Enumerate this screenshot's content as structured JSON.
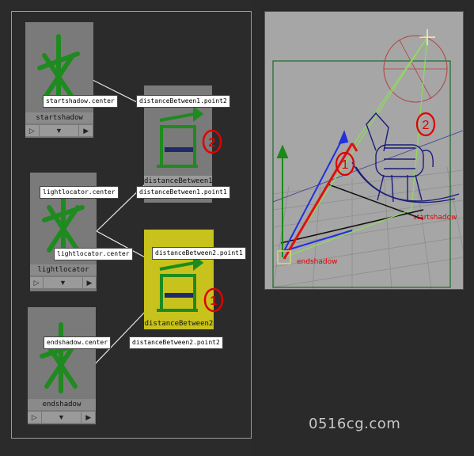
{
  "hypergraph": {
    "nodes": {
      "startshadow": {
        "label": "startshadow"
      },
      "dist1": {
        "label": "distanceBetween1"
      },
      "lightlocator": {
        "label": "lightlocator"
      },
      "dist2": {
        "label": "distanceBetween2"
      },
      "endshadow": {
        "label": "endshadow"
      }
    },
    "tags": {
      "t1": "startshadow.center",
      "t2": "distanceBetween1.point2",
      "t3": "lightlocator.center",
      "t4": "distanceBetween1.point1",
      "t5": "lightlocator.center",
      "t6": "distanceBetween2.point1",
      "t7": "endshadow.center",
      "t8": "distanceBetween2.point2"
    },
    "markers": {
      "m2": "2",
      "m1": "1"
    },
    "bar_symbols": {
      "play": "▷",
      "down": "▼",
      "right": "▶"
    }
  },
  "viewport": {
    "labels": {
      "startshadow": "startshadow",
      "endshadow": "endshadow"
    },
    "markers": {
      "m1": "1",
      "m2": "2"
    }
  },
  "watermark": "0516cg.com",
  "colors": {
    "selected_node": "#c8c21c",
    "marker": "#e00000",
    "locator_green": "#1f8a1f"
  }
}
